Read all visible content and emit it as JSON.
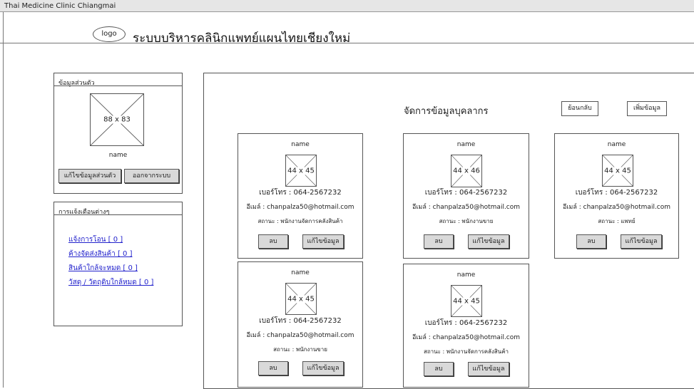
{
  "window": {
    "title": "Thai Medicine Clinic Chiangmai"
  },
  "header": {
    "logo_label": "logo",
    "title": "ระบบบริหารคลินิกแพทย์แผนไทยเชียงใหม่"
  },
  "profile_panel": {
    "title": "ข้อมูลส่วนตัว",
    "avatar_label": "88 x 83",
    "name": "name",
    "edit_button": "แก้ไขข้อมูลส่วนตัว",
    "logout_button": "ออกจากระบบ"
  },
  "notify_panel": {
    "title": "การแจ้งเตือนต่างๆ",
    "links": [
      "แจ้งการโอน [ 0 ]",
      "ค้างจัดส่งสินค้า [ 0 ]",
      "สินค้าใกล้จะหมด [ 0 ]",
      "วัสดุ / วัตถุดิบใกล้หมด [ 0 ]"
    ]
  },
  "main": {
    "title": "จัดการข้อมูลบุคลากร",
    "back_button": "ย้อนกลับ",
    "add_button": "เพิ่มข้อมูล"
  },
  "cards": [
    {
      "name": "name",
      "img": "44 x 45",
      "phone": "เบอร์โทร : 064-2567232",
      "email": "อีเมล์ : chanpalza50@hotmail.com",
      "status": "สถานะ : พนักงานจัดการคลังสินค้า",
      "delete": "ลบ",
      "edit": "แก้ไขข้อมูล"
    },
    {
      "name": "name",
      "img": "44 x 46",
      "phone": "เบอร์โทร : 064-2567232",
      "email": "อีเมล์ : chanpalza50@hotmail.com",
      "status": "สถานะ : พนักงานขาย",
      "delete": "ลบ",
      "edit": "แก้ไขข้อมูล"
    },
    {
      "name": "name",
      "img": "44 x 45",
      "phone": "เบอร์โทร : 064-2567232",
      "email": "อีเมล์ : chanpalza50@hotmail.com",
      "status": "สถานะ : แพทย์",
      "delete": "ลบ",
      "edit": "แก้ไขข้อมูล"
    },
    {
      "name": "name",
      "img": "44 x 45",
      "phone": "เบอร์โทร : 064-2567232",
      "email": "อีเมล์ : chanpalza50@hotmail.com",
      "status": "สถานะ : พนักงานขาย",
      "delete": "ลบ",
      "edit": "แก้ไขข้อมูล"
    },
    {
      "name": "name",
      "img": "44 x 45",
      "phone": "เบอร์โทร : 064-2567232",
      "email": "อีเมล์ : chanpalza50@hotmail.com",
      "status": "สถานะ : พนักงานจัดการคลังสินค้า",
      "delete": "ลบ",
      "edit": "แก้ไขข้อมูล"
    }
  ]
}
